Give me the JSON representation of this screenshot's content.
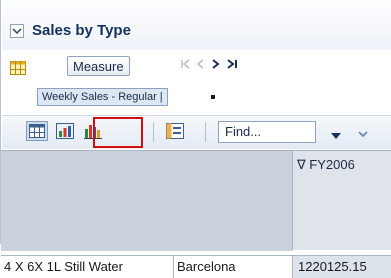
{
  "panel": {
    "title": "Sales by Type"
  },
  "measure": {
    "button_label": "Measure",
    "selected_tag": "Weekly Sales - Regular |",
    "nav": {
      "first": "|<",
      "prev": "<",
      "next": ">",
      "last": ">|"
    }
  },
  "toolbar": {
    "find_placeholder": "Find...",
    "highlighted_tool": "chart-view"
  },
  "grid": {
    "column_header": "∇ FY2006",
    "rows": [
      {
        "product": "4 X 6X 1L Still Water",
        "city": "Barcelona",
        "value": "1220125.15"
      }
    ]
  },
  "colors": {
    "title": "#15325f",
    "highlight_border": "#d01010",
    "header_bg": "#c9d1dc"
  }
}
